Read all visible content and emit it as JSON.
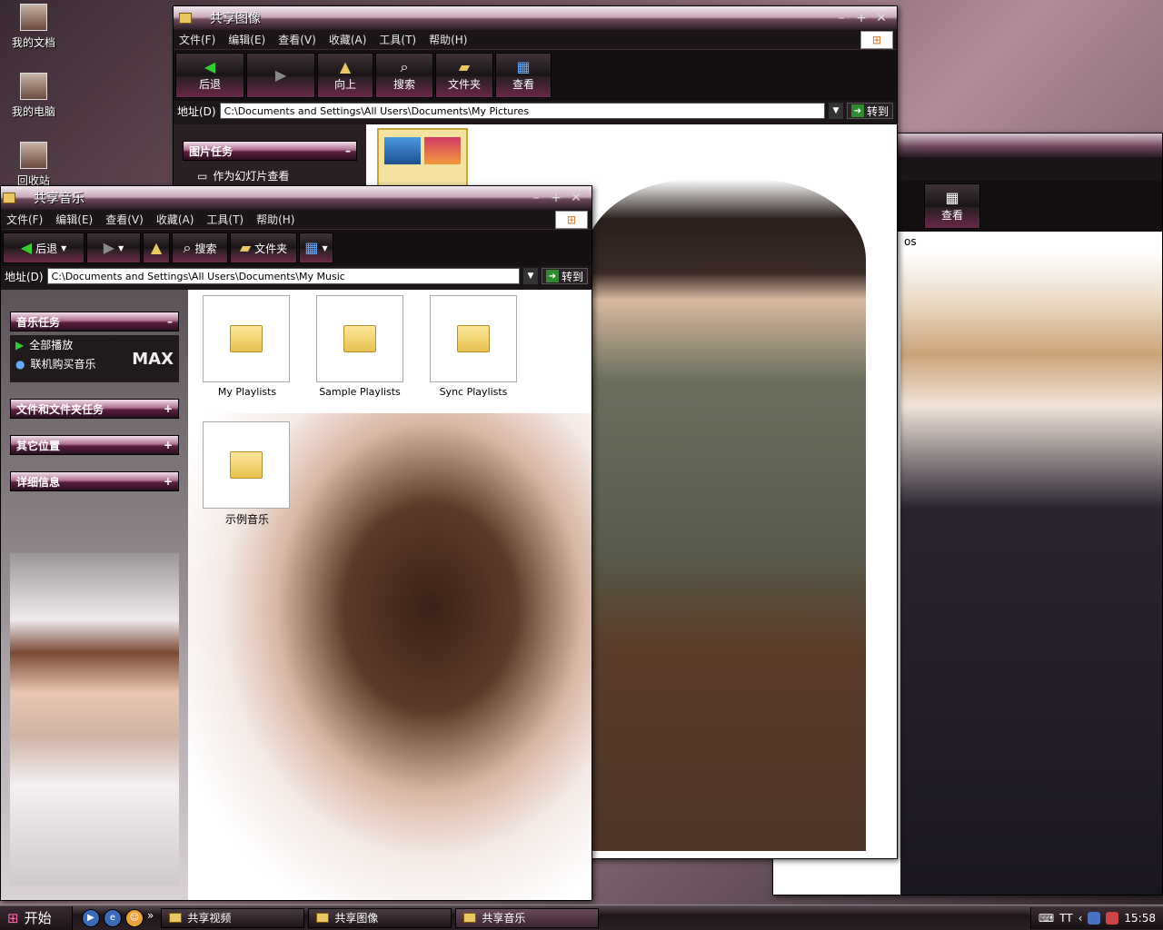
{
  "desktop_icons": [
    {
      "label": "我的文档"
    },
    {
      "label": "我的电脑"
    },
    {
      "label": "回收站"
    }
  ],
  "win_pictures": {
    "title": "共享图像",
    "menu": [
      "文件(F)",
      "编辑(E)",
      "查看(V)",
      "收藏(A)",
      "工具(T)",
      "帮助(H)"
    ],
    "toolbar": {
      "back": "后退",
      "up": "向上",
      "search": "搜索",
      "folders": "文件夹",
      "views": "查看"
    },
    "address_label": "地址(D)",
    "address": "C:\\Documents and Settings\\All Users\\Documents\\My Pictures",
    "go": "转到",
    "tasks_title": "图片任务",
    "tasks": [
      "作为幻灯片查看"
    ]
  },
  "win_video": {
    "views": "查看",
    "address_tail": "os"
  },
  "win_music": {
    "title": "共享音乐",
    "menu": [
      "文件(F)",
      "编辑(E)",
      "查看(V)",
      "收藏(A)",
      "工具(T)",
      "帮助(H)"
    ],
    "toolbar": {
      "back": "后退",
      "search": "搜索",
      "folders": "文件夹"
    },
    "address_label": "地址(D)",
    "address": "C:\\Documents and Settings\\All Users\\Documents\\My Music",
    "go": "转到",
    "music_tasks_title": "音乐任务",
    "music_tasks": [
      "全部播放",
      "联机购买音乐"
    ],
    "brand": "MAX",
    "panels": [
      "文件和文件夹任务",
      "其它位置",
      "详细信息"
    ],
    "folders": [
      "My Playlists",
      "Sample Playlists",
      "Sync Playlists",
      "示例音乐"
    ]
  },
  "taskbar": {
    "start": "开始",
    "buttons": [
      "共享视频",
      "共享图像",
      "共享音乐"
    ],
    "tray_text": "TT",
    "clock": "15:58"
  }
}
